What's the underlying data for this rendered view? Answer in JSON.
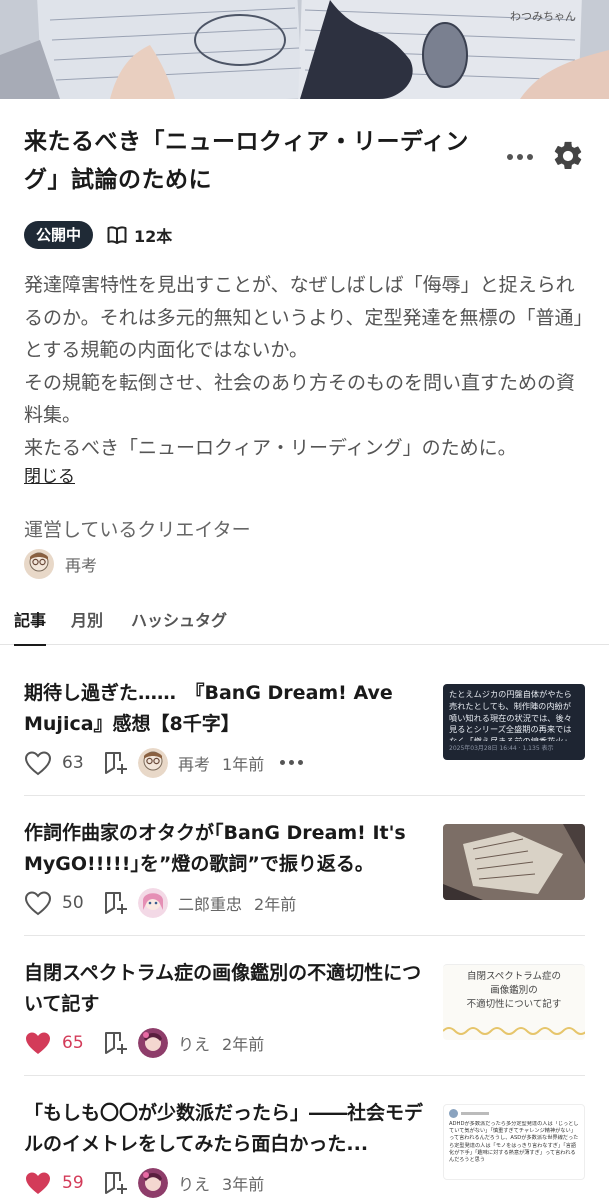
{
  "magazine": {
    "title": "来たるべき「ニューロクィア・リーディング」試論のために",
    "status": "公開中",
    "article_count": "12本",
    "description": "発達障害特性を見出すことが、なぜしばしば「侮辱」と捉えられるのか。それは多元的無知というより、定型発達を無標の「普通」とする規範の内面化ではないか。\nその規範を転倒させ、社会のあり方そのものを問い直すための資料集。\n来たるべき「ニューロクィア・リーディング」のために。",
    "close_label": "閉じる"
  },
  "creators": {
    "heading": "運営しているクリエイター",
    "items": [
      {
        "name": "再考"
      }
    ]
  },
  "tabs": [
    {
      "label": "記事",
      "active": true
    },
    {
      "label": "月別",
      "active": false
    },
    {
      "label": "ハッシュタグ",
      "active": false
    }
  ],
  "articles": [
    {
      "title": "期待し過ぎた……　『BanG Dream! Ave Mujica』感想【8千字】",
      "likes": "63",
      "liked": false,
      "author": "再考",
      "time": "1年前",
      "show_more": true,
      "thumb_text": "たとえムジカの円盤自体がやたら売れたとしても、制作陣の内紛が噴い知れる現在の状況では、後々見るとシリーズ全盛期の再来ではなく「燃え尽きる前の線香花火」だったということになりかねない気もする",
      "thumb_meta": "2025年03月28日 16:44 · 1,135 表示"
    },
    {
      "title": "作詞作曲家のオタクが｢BanG Dream! It's MyGO!!!!!｣を”燈の歌詞”で振り返る。",
      "likes": "50",
      "liked": false,
      "author": "二郎重忠",
      "time": "2年前",
      "show_more": false
    },
    {
      "title": "自閉スペクトラム症の画像鑑別の不適切性について記す",
      "likes": "65",
      "liked": true,
      "author": "りえ",
      "time": "2年前",
      "show_more": false,
      "thumb_text": "自閉スペクトラム症の\n画像鑑別の\n不適切性について記す"
    },
    {
      "title": "「もしも〇〇が少数派だったら」――社会モデルのイメトレをしてみたら面白かった...",
      "likes": "59",
      "liked": true,
      "author": "りえ",
      "time": "3年前",
      "show_more": false,
      "thumb_text": "ADHDが多数派だったら多分定型発達の人は「じっとしていて気がない」「慎重すぎてチャレンジ精神がない」って言われるんだろうし、ASDが多数派な世界線だったら定型発達の人は「モノをはっきり言わなすぎ」「言語化が下手」「趣味に対する熱意が薄すぎ」って言われるんだろうと思う"
    }
  ],
  "colors": {
    "accent_like": "#d33b59",
    "badge_bg": "#1f2a36",
    "text_primary": "#1a1a1a",
    "text_secondary": "#555555"
  }
}
